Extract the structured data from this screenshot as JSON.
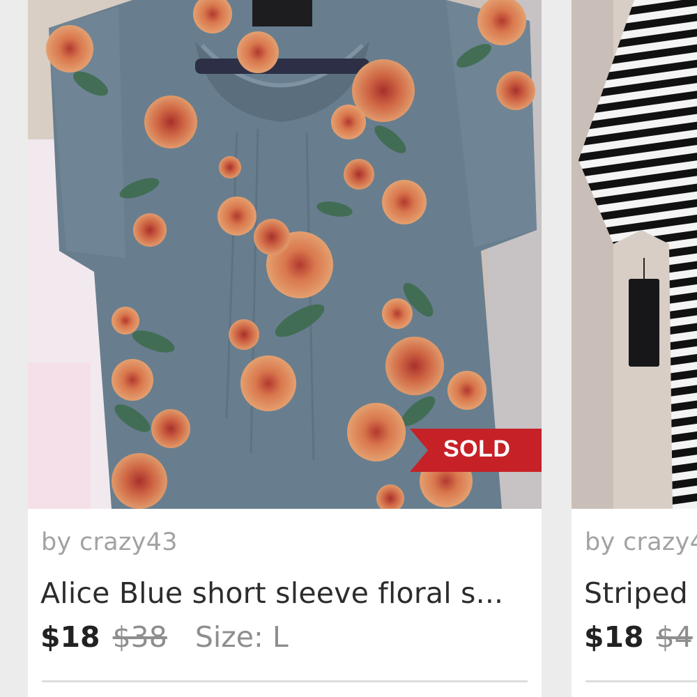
{
  "listings": [
    {
      "seller": "by crazy43",
      "title": "Alice Blue short sleeve floral s...",
      "price": "$18",
      "original_price": "$38",
      "size": "Size: L",
      "status_badge": "SOLD",
      "image_description_icon": "floral-blouse-photo"
    },
    {
      "seller": "by crazy4",
      "title": "Striped",
      "price": "$18",
      "original_price": "$4",
      "image_description_icon": "striped-dress-photo"
    }
  ],
  "colors": {
    "sold_badge": "#c62127",
    "page_background": "#ececec",
    "seller_text": "#a2a2a2",
    "title_text": "#2c2c2c"
  }
}
